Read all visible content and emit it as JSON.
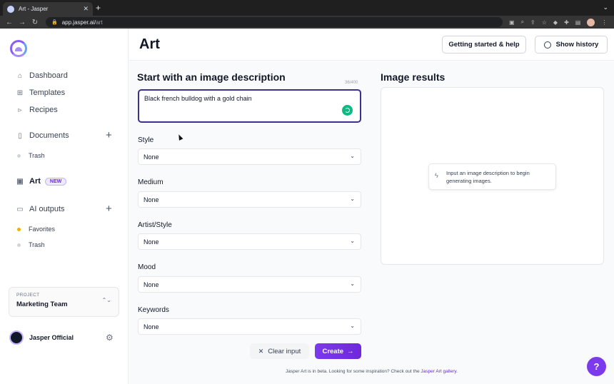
{
  "browser": {
    "tab_title": "Art - Jasper",
    "tab_close": "✕",
    "new_tab": "+",
    "url_host": "app.jasper.ai/",
    "url_path": "art"
  },
  "sidebar": {
    "items": [
      {
        "label": "Dashboard",
        "icon": "home-icon"
      },
      {
        "label": "Templates",
        "icon": "grid-icon"
      },
      {
        "label": "Recipes",
        "icon": "terminal-icon"
      },
      {
        "label": "Documents",
        "icon": "document-icon"
      },
      {
        "label": "Trash",
        "icon": "dot"
      },
      {
        "label": "Art",
        "icon": "image-icon",
        "badge": "NEW"
      },
      {
        "label": "AI outputs",
        "icon": "inbox-icon"
      },
      {
        "label": "Favorites",
        "icon": "dot",
        "color": "#eab308"
      },
      {
        "label": "Trash",
        "icon": "dot"
      }
    ],
    "project": {
      "label": "PROJECT",
      "name": "Marketing Team"
    },
    "user": {
      "name": "Jasper Official"
    }
  },
  "header": {
    "title": "Art",
    "help_button": "Getting started & help",
    "history_button": "Show history"
  },
  "form": {
    "heading": "Start with an image description",
    "counter": "36/400",
    "description": "Black french bulldog with a gold chain",
    "fields": [
      {
        "label": "Style",
        "value": "None"
      },
      {
        "label": "Medium",
        "value": "None"
      },
      {
        "label": "Artist/Style",
        "value": "None"
      },
      {
        "label": "Mood",
        "value": "None"
      },
      {
        "label": "Keywords",
        "value": "None"
      }
    ],
    "clear_button": "Clear input",
    "create_button": "Create"
  },
  "results": {
    "heading": "Image results",
    "hint": "Input an image description to begin generating images."
  },
  "footer": {
    "note": "Jasper Art is in beta. Looking for some inspiration? Check out the",
    "link": "Jasper Art gallery",
    "end": "."
  },
  "help_fab": "?",
  "colors": {
    "accent": "#7c3aed",
    "focus_border": "#3b2f8f",
    "favorite_dot": "#eab308",
    "spinner": "#10b981"
  }
}
